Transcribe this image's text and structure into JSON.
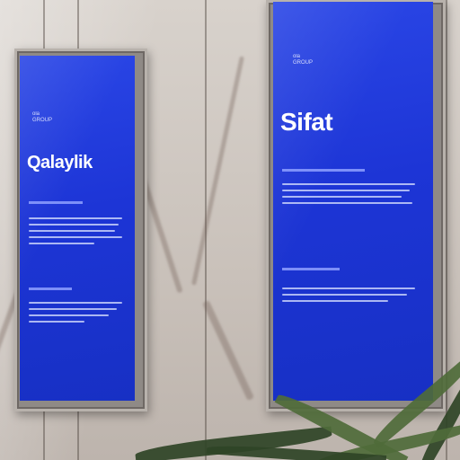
{
  "scene": {
    "description": "Two vertical blue digital display screens mounted on a marble wall, with a plant in the foreground"
  },
  "left_screen": {
    "title": "Qalaylik",
    "logo_line1": "ola",
    "logo_line2": "GROUP"
  },
  "right_screen": {
    "title": "Sifat",
    "logo_line1": "ola",
    "logo_line2": "GROUP"
  },
  "colors": {
    "screen_blue": "#1d35d6",
    "wall": "#cfc8c2",
    "plant": "#4f6b3a"
  }
}
